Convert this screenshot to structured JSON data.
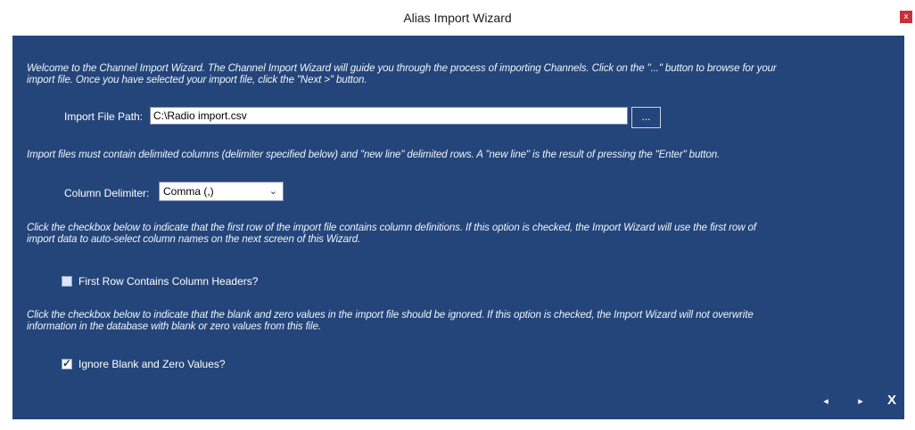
{
  "window": {
    "title": "Alias Import Wizard",
    "close_label": "x"
  },
  "intro_text_line1": "Welcome to the Channel Import Wizard.  The Channel Import Wizard will guide you through the process of importing Channels.  Click on the \"...\" button to browse for your",
  "intro_text_line2": "import file.  Once you have selected your import file, click the \"Next >\" button.",
  "import_file": {
    "label": "Import File Path:",
    "value": "C:\\Radio import.csv",
    "browse_label": "..."
  },
  "delimited_text": "Import files must contain delimited columns (delimiter specified below) and \"new line\" delimited rows.  A \"new line\" is the result of pressing the \"Enter\" button.",
  "column_delimiter": {
    "label": "Column Delimiter:",
    "selected": "Comma (,)"
  },
  "headers_help_line1": "Click the checkbox below to indicate that the first row of the import file contains column definitions.  If this option is checked, the Import Wizard will use the first row of",
  "headers_help_line2": "import data to auto-select column names on the next screen of this Wizard.",
  "first_row_headers": {
    "label": "First Row Contains Column Headers?",
    "checked": false
  },
  "ignore_help_line1": "Click the checkbox below to indicate that the blank and zero values in the import file should be ignored.  If this option is checked, the Import Wizard will not overwrite",
  "ignore_help_line2": "information in the database with blank or zero values from this file.",
  "ignore_blank": {
    "label": "Ignore Blank and Zero Values?",
    "checked": true
  },
  "nav": {
    "back": "◂",
    "next": "▸",
    "cancel": "X"
  }
}
